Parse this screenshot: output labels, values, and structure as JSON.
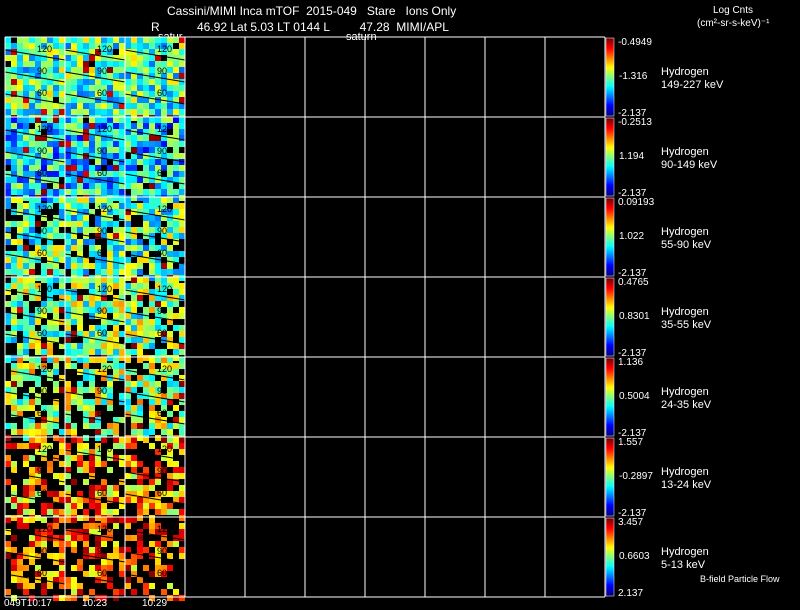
{
  "header": {
    "title": "Cassini/MIMI Inca mTOF  2015-049   Stare   Ions Only",
    "subtitle_r": "R",
    "subtitle_vals": "46.92 Lat 5.03 LT 0144 L         47.28  MIMI/APL",
    "label_saturn_left": "satur",
    "label_saturn_mid": "saturn",
    "units_title": "Log Cnts",
    "units_label": "(cm²-sr-s-keV)⁻¹"
  },
  "panels": [
    {
      "species": "Hydrogen",
      "energy": "149-227 keV",
      "max": "-0.4949",
      "mid": "-1.316",
      "min": "-2.137"
    },
    {
      "species": "Hydrogen",
      "energy": "90-149 keV",
      "max": "-0.2513",
      "mid": "1.194",
      "min": "-2.137"
    },
    {
      "species": "Hydrogen",
      "energy": "55-90 keV",
      "max": "0.09193",
      "mid": "1.022",
      "min": "-2.137"
    },
    {
      "species": "Hydrogen",
      "energy": "35-55 keV",
      "max": "0.4765",
      "mid": "0.8301",
      "min": "-2.137"
    },
    {
      "species": "Hydrogen",
      "energy": "24-35 keV",
      "max": "1.136",
      "mid": "0.5004",
      "min": "-2.137"
    },
    {
      "species": "Hydrogen",
      "energy": "13-24 keV",
      "max": "1.557",
      "mid": "-0.2897",
      "min": "-2.137"
    },
    {
      "species": "Hydrogen",
      "energy": "5-13 keV",
      "max": "3.457",
      "mid": "0.6603",
      "min": "2.137"
    }
  ],
  "time_labels": [
    "049T10:17",
    "10:23",
    "10:29"
  ],
  "footer_note": "B-field Particle Flow",
  "contour_labels": [
    "120",
    "90",
    "60"
  ],
  "colors": {
    "grid": "#ffffff",
    "background": "#000000"
  }
}
